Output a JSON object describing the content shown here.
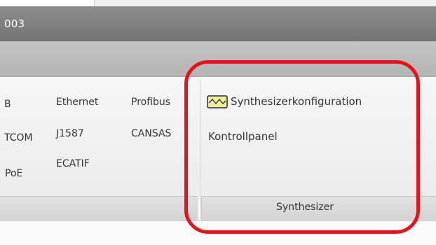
{
  "window": {
    "title_fragment": "003"
  },
  "ribbon_left": {
    "items": [
      {
        "label": "B"
      },
      {
        "label": "TCOM"
      },
      {
        "label": "PoE"
      },
      {
        "label": "Ethernet"
      },
      {
        "label": "J1587"
      },
      {
        "label": "ECATIF"
      },
      {
        "label": "Profibus"
      },
      {
        "label": "CANSAS"
      }
    ]
  },
  "synthesizer_group": {
    "label": "Synthesizer",
    "config_button": {
      "label": "Synthesizerkonfiguration",
      "icon": "waveform-icon"
    },
    "control_panel_button": {
      "label": "Kontrollpanel"
    }
  },
  "annotation": {
    "color": "#e4141a"
  }
}
